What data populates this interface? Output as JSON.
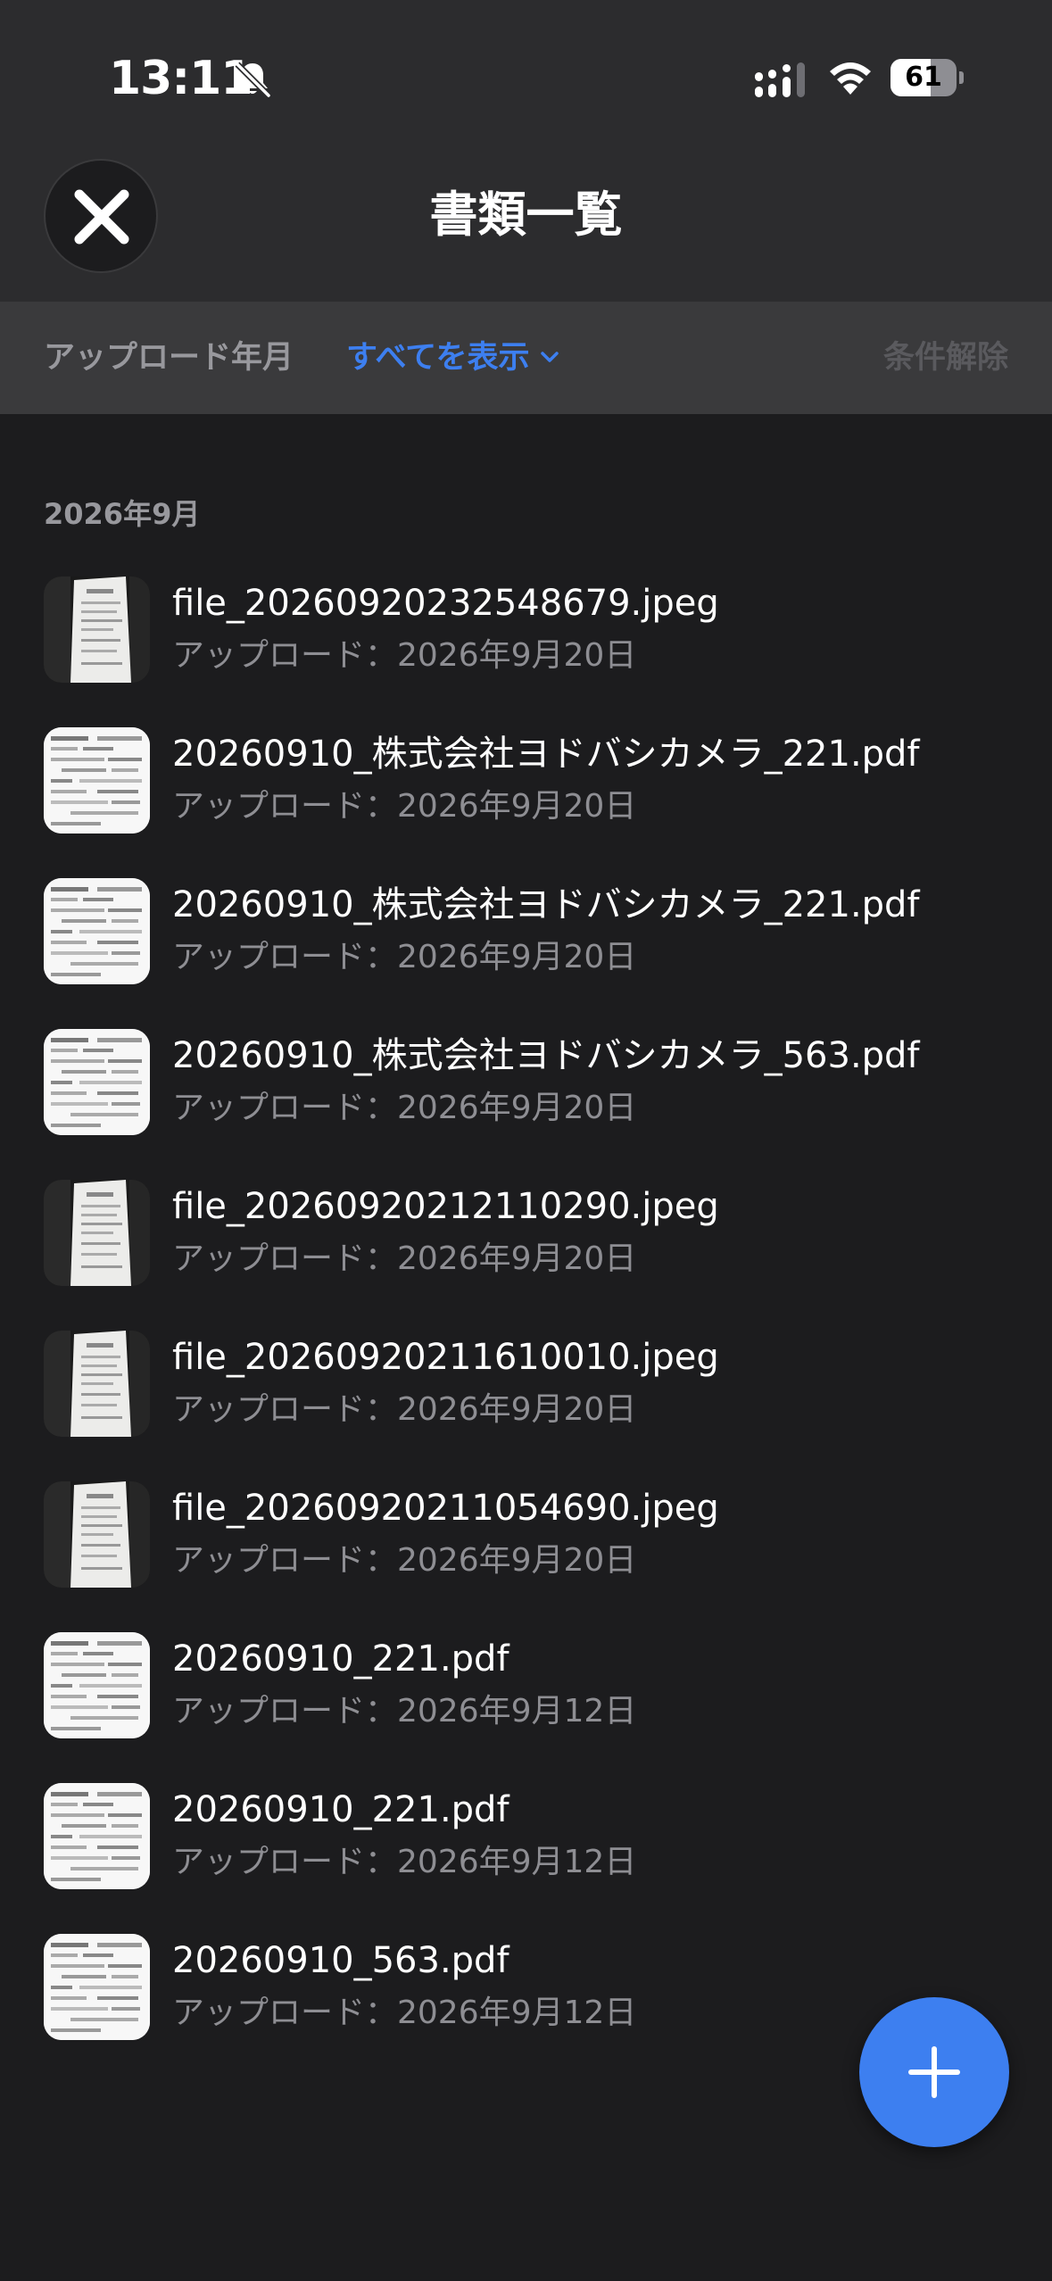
{
  "status_bar": {
    "time": "13:11",
    "battery_level": "61",
    "battery_fraction": 0.61
  },
  "nav": {
    "title": "書類一覧",
    "close_icon": "close-icon"
  },
  "filter": {
    "label": "アップロード年月",
    "selected": "すべてを表示",
    "clear_label": "条件解除"
  },
  "list": {
    "section_header": "2026年9月",
    "items": [
      {
        "name": "file_20260920232548679.jpeg",
        "uploaded": "アップロード：2026年9月20日",
        "thumb": "photo"
      },
      {
        "name": "20260910_株式会社ヨドバシカメラ_221.pdf",
        "uploaded": "アップロード：2026年9月20日",
        "thumb": "document"
      },
      {
        "name": "20260910_株式会社ヨドバシカメラ_221.pdf",
        "uploaded": "アップロード：2026年9月20日",
        "thumb": "document"
      },
      {
        "name": "20260910_株式会社ヨドバシカメラ_563.pdf",
        "uploaded": "アップロード：2026年9月20日",
        "thumb": "document"
      },
      {
        "name": "file_20260920212110290.jpeg",
        "uploaded": "アップロード：2026年9月20日",
        "thumb": "photo"
      },
      {
        "name": "file_20260920211610010.jpeg",
        "uploaded": "アップロード：2026年9月20日",
        "thumb": "photo"
      },
      {
        "name": "file_20260920211054690.jpeg",
        "uploaded": "アップロード：2026年9月20日",
        "thumb": "photo"
      },
      {
        "name": "20260910_221.pdf",
        "uploaded": "アップロード：2026年9月12日",
        "thumb": "document"
      },
      {
        "name": "20260910_221.pdf",
        "uploaded": "アップロード：2026年9月12日",
        "thumb": "document"
      },
      {
        "name": "20260910_563.pdf",
        "uploaded": "アップロード：2026年9月12日",
        "thumb": "document"
      }
    ]
  },
  "fab": {
    "icon": "plus-icon"
  },
  "colors": {
    "background": "#1c1c1e",
    "header": "#2c2c2e",
    "filter_bar": "#3a3a3c",
    "accent": "#3d7ff0",
    "secondary_text": "#8e8e93"
  }
}
